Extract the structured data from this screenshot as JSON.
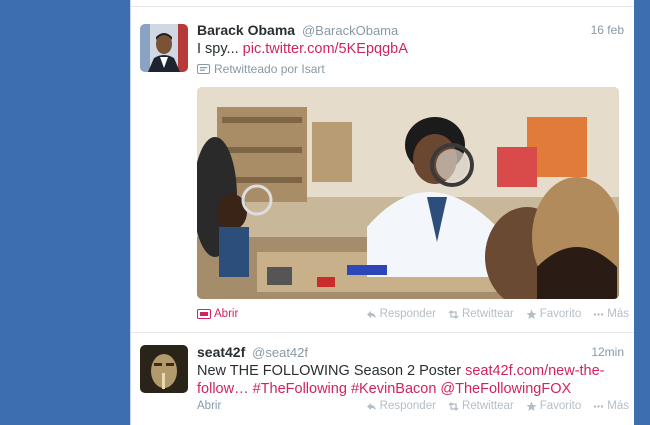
{
  "tweets": [
    {
      "fullname": "Barack Obama",
      "username": "@BarackObama",
      "time": "16 feb",
      "text_prefix": "I spy... ",
      "link": "pic.twitter.com/5KEpqgbA",
      "retweeted_by": "Retwitteado por Isart",
      "open_label": "Abrir"
    },
    {
      "fullname": "seat42f",
      "username": "@seat42f",
      "time": "12min",
      "text_prefix": "New THE FOLLOWING Season 2 Poster ",
      "link": "seat42f.com/new-the-follow…",
      "hashtags": "#TheFollowing #KevinBacon @TheFollowingFOX",
      "open_label": "Abrir"
    }
  ],
  "actions": {
    "reply": "Responder",
    "retweet": "Retwittear",
    "favorite": "Favorito",
    "more": "Más"
  },
  "icons": {
    "reply": "reply-icon",
    "retweet": "retweet-icon",
    "favorite": "star-icon",
    "more": "more-dots-icon",
    "photo": "photo-icon"
  },
  "colors": {
    "link": "#d1245c",
    "background": "#3d6fae",
    "muted": "#8899a6"
  }
}
